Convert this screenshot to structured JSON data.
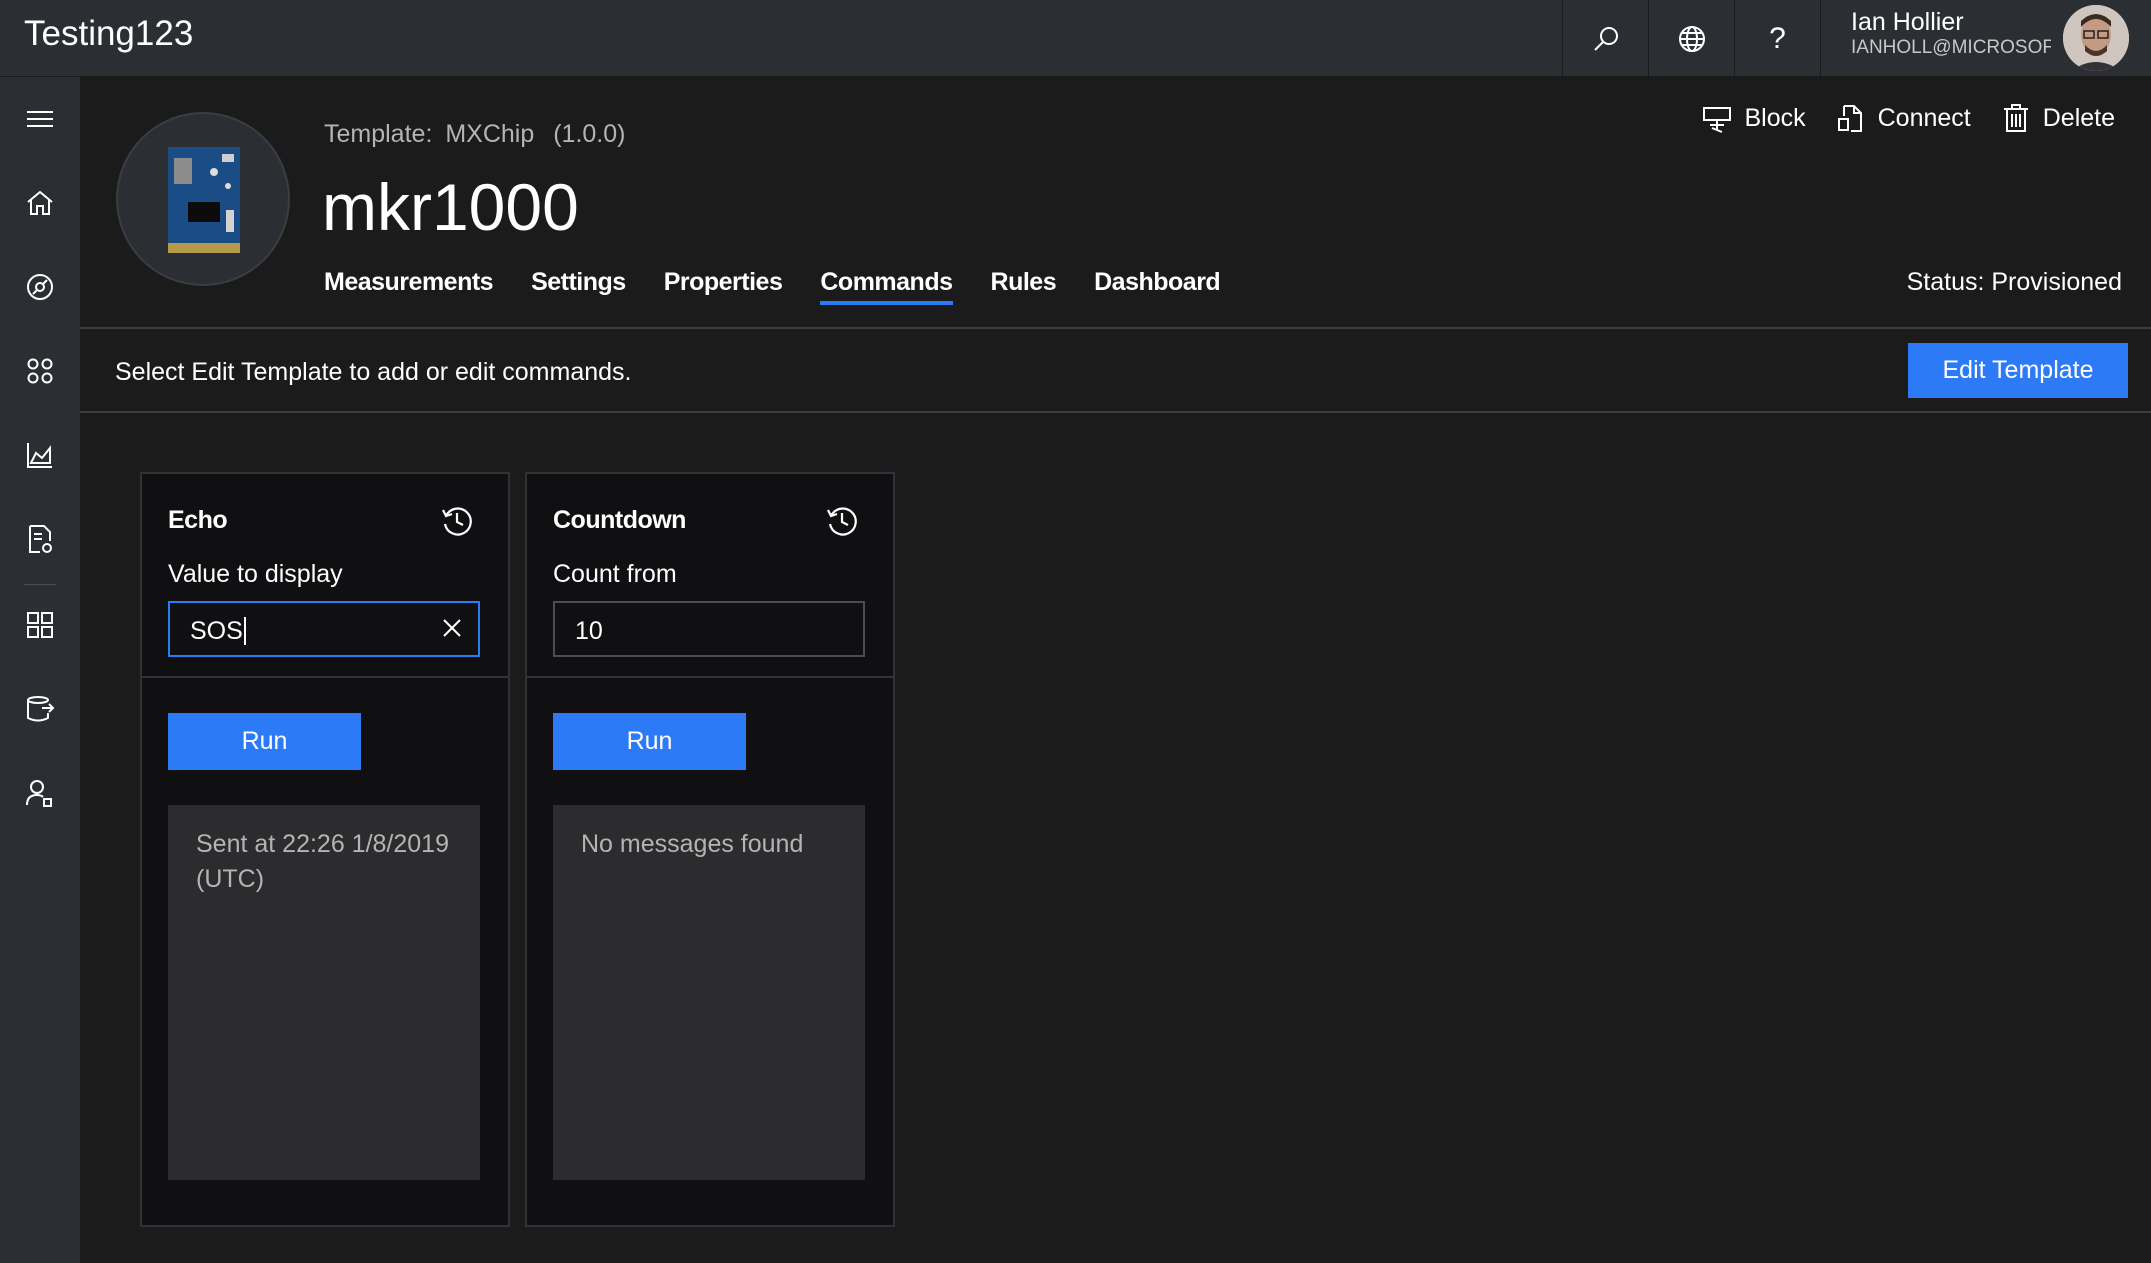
{
  "app": {
    "title": "Testing123"
  },
  "topbar": {
    "icons": [
      "search-icon",
      "globe-icon",
      "help-icon"
    ],
    "help_glyph": "?",
    "user": {
      "name": "Ian Hollier",
      "email": "IANHOLL@MICROSOF..."
    }
  },
  "rail": {
    "items": [
      "menu-icon",
      "home-icon",
      "device-explorer-icon",
      "device-sets-icon",
      "analytics-icon",
      "jobs-icon",
      "device-templates-icon",
      "continuous-export-icon",
      "administration-icon"
    ]
  },
  "device": {
    "template_prefix": "Template:",
    "template_name": "MXChip",
    "template_version": "(1.0.0)",
    "name": "mkr1000",
    "status": "Status: Provisioned"
  },
  "tabs": [
    {
      "label": "Measurements",
      "active": false
    },
    {
      "label": "Settings",
      "active": false
    },
    {
      "label": "Properties",
      "active": false
    },
    {
      "label": "Commands",
      "active": true
    },
    {
      "label": "Rules",
      "active": false
    },
    {
      "label": "Dashboard",
      "active": false
    }
  ],
  "actions": {
    "block": "Block",
    "connect": "Connect",
    "delete": "Delete"
  },
  "hint": {
    "text": "Select Edit Template to add or edit commands.",
    "button": "Edit Template"
  },
  "commands": [
    {
      "title": "Echo",
      "field_label": "Value to display",
      "value": "SOS",
      "run_label": "Run",
      "message": "Sent at 22:26 1/8/2019 (UTC)"
    },
    {
      "title": "Countdown",
      "field_label": "Count from",
      "value": "10",
      "run_label": "Run",
      "message": "No messages found"
    }
  ],
  "colors": {
    "accent": "#2d7af6",
    "topbar": "#2b2e33",
    "background": "#1b1b1c"
  }
}
